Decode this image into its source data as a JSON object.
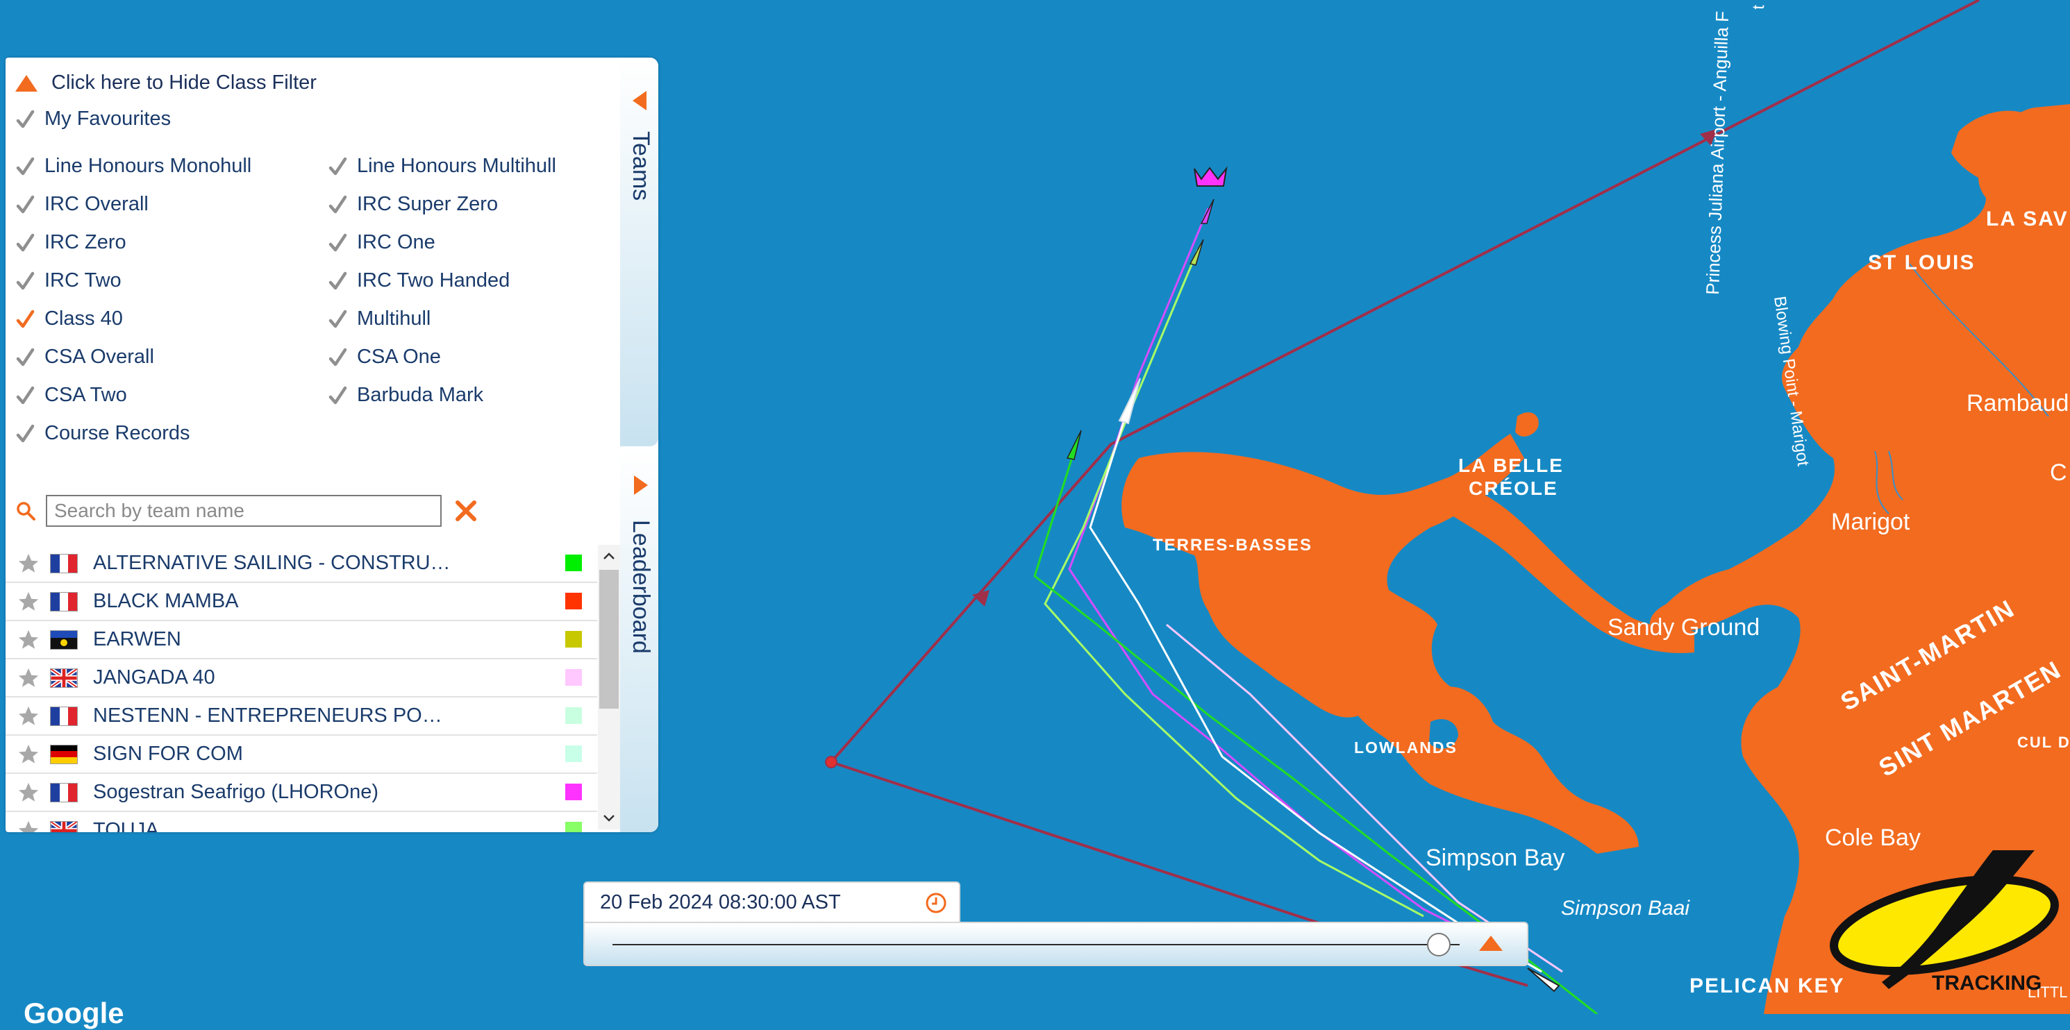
{
  "filter": {
    "hide_label": "Click here to Hide Class Filter",
    "favourites": {
      "label": "My Favourites",
      "checked": false
    },
    "classes": [
      {
        "label": "Line Honours Monohull",
        "checked": false
      },
      {
        "label": "Line Honours Multihull",
        "checked": false
      },
      {
        "label": "IRC Overall",
        "checked": false
      },
      {
        "label": "IRC Super Zero",
        "checked": false
      },
      {
        "label": "IRC Zero",
        "checked": false
      },
      {
        "label": "IRC One",
        "checked": false
      },
      {
        "label": "IRC Two",
        "checked": false
      },
      {
        "label": "IRC Two Handed",
        "checked": false
      },
      {
        "label": "Class 40",
        "checked": true
      },
      {
        "label": "Multihull",
        "checked": false
      },
      {
        "label": "CSA Overall",
        "checked": false
      },
      {
        "label": "CSA One",
        "checked": false
      },
      {
        "label": "CSA Two",
        "checked": false
      },
      {
        "label": "Barbuda Mark",
        "checked": false
      },
      {
        "label": "Course Records",
        "checked": false
      }
    ]
  },
  "search": {
    "placeholder": "Search by team name",
    "value": ""
  },
  "teams": [
    {
      "name": "ALTERNATIVE SAILING - CONSTRU…",
      "flag": "fr",
      "color": "#00ee00"
    },
    {
      "name": "BLACK MAMBA",
      "flag": "fr",
      "color": "#ff3300"
    },
    {
      "name": "EARWEN",
      "flag": "gp",
      "color": "#c8c800"
    },
    {
      "name": "JANGADA 40",
      "flag": "gb",
      "color": "#ffc8ff"
    },
    {
      "name": "NESTENN - ENTREPRENEURS PO…",
      "flag": "fr",
      "color": "#c8ffe0"
    },
    {
      "name": "SIGN FOR COM",
      "flag": "de",
      "color": "#c8ffe8"
    },
    {
      "name": "Sogestran Seafrigo (LHOROne)",
      "flag": "fr",
      "color": "#ff33ff"
    },
    {
      "name": "TOUJA",
      "flag": "gb",
      "color": "#88ff66"
    }
  ],
  "tabs": {
    "teams": "Teams",
    "leaderboard": "Leaderboard"
  },
  "time": {
    "display": "20 Feb 2024 08:30:00 AST",
    "slider_position": 0.975
  },
  "map_labels": {
    "terres_basses": "TERRES-BASSES",
    "la_belle_1": "LA BELLE",
    "la_belle_2": "CRÉOLE",
    "lowlands": "LOWLANDS",
    "sandy_ground": "Sandy Ground",
    "simpson_bay": "Simpson Bay",
    "simpson_baai": "Simpson Baai",
    "marigot": "Marigot",
    "st_louis": "ST LOUIS",
    "la_sav": "LA SAV",
    "rambaud": "Rambaud",
    "c_label": "C",
    "saint_martin": "SAINT-MARTIN",
    "sint_maarten": "SINT MAARTEN",
    "cul_d": "CUL D",
    "cole_bay": "Cole Bay",
    "pelican_key": "PELICAN KEY",
    "littl": "LITTL",
    "airport": "Princess Juliana Airport - Anguilla F",
    "blowing_point": "Blowing Point - Marigot",
    "top_t": "t"
  },
  "logo": {
    "text": "TRACKING"
  },
  "google": "Google",
  "colors": {
    "sea": "#1689c5",
    "land": "#f26b1f",
    "course": "#a02f4a",
    "accent": "#f26b1f"
  }
}
